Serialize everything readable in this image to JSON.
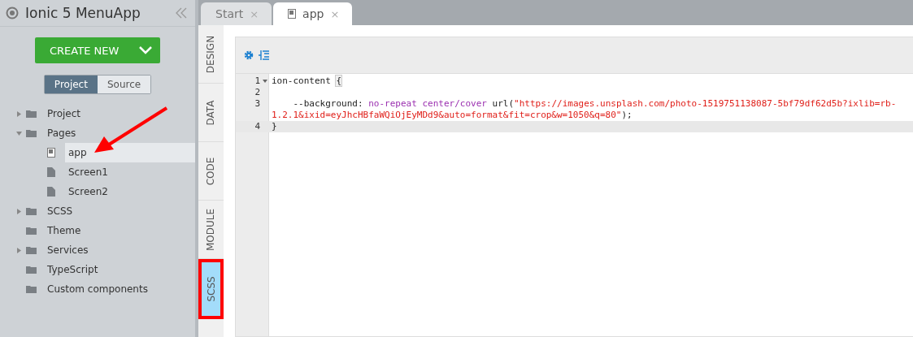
{
  "sidebar": {
    "title": "Ionic 5 MenuApp",
    "create_button": "CREATE NEW",
    "view_toggle": [
      {
        "label": "Project",
        "selected": true
      },
      {
        "label": "Source",
        "selected": false
      }
    ],
    "tree": [
      {
        "label": "Project",
        "kind": "folder",
        "expanded": false,
        "selected": false
      },
      {
        "label": "Pages",
        "kind": "folder",
        "expanded": true,
        "selected": false,
        "children": [
          {
            "label": "app",
            "kind": "page",
            "selected": true
          },
          {
            "label": "Screen1",
            "kind": "page",
            "selected": false
          },
          {
            "label": "Screen2",
            "kind": "page",
            "selected": false
          }
        ]
      },
      {
        "label": "SCSS",
        "kind": "folder",
        "expanded": false,
        "selected": false
      },
      {
        "label": "Theme",
        "kind": "folder",
        "selected": false
      },
      {
        "label": "Services",
        "kind": "folder",
        "expanded": false,
        "selected": false
      },
      {
        "label": "TypeScript",
        "kind": "folder",
        "selected": false
      },
      {
        "label": "Custom components",
        "kind": "folder",
        "selected": false
      }
    ]
  },
  "tabs": [
    {
      "label": "Start",
      "close": "×",
      "selected": false,
      "icon": false
    },
    {
      "label": "app",
      "close": "×",
      "selected": true,
      "icon": true
    }
  ],
  "side_tabs": [
    {
      "label": "DESIGN",
      "selected": false,
      "annotated": false
    },
    {
      "label": "DATA",
      "selected": false,
      "annotated": false
    },
    {
      "label": "CODE",
      "selected": false,
      "annotated": false
    },
    {
      "label": "MODULE",
      "selected": false,
      "annotated": false
    },
    {
      "label": "SCSS",
      "selected": true,
      "annotated": true
    }
  ],
  "editor": {
    "lines": [
      {
        "number": "1",
        "fold": true,
        "active": false,
        "tokens": [
          {
            "kind": "plain",
            "text": "ion-content "
          },
          {
            "kind": "bracket",
            "text": "{"
          }
        ]
      },
      {
        "number": "2",
        "fold": false,
        "active": false
      },
      {
        "number": "3",
        "fold": false,
        "active": false,
        "tokens": [
          {
            "kind": "plain",
            "text": "    --background: "
          },
          {
            "kind": "keyword",
            "text": "no-repeat center/cover"
          },
          {
            "kind": "plain",
            "text": " url("
          },
          {
            "kind": "string",
            "text": "\"https://images.unsplash.com/photo-1519751138087-5bf79df62d5b?ixlib=rb-1.2.1&ixid=eyJhcHBfaWQiOjEyMDd9&auto=format&fit=crop&w=1050&q=80\""
          },
          {
            "kind": "plain",
            "text": ");"
          }
        ]
      },
      {
        "number": "4",
        "fold": false,
        "active": true,
        "tokens": [
          {
            "kind": "plain",
            "text": "}"
          }
        ]
      }
    ]
  }
}
